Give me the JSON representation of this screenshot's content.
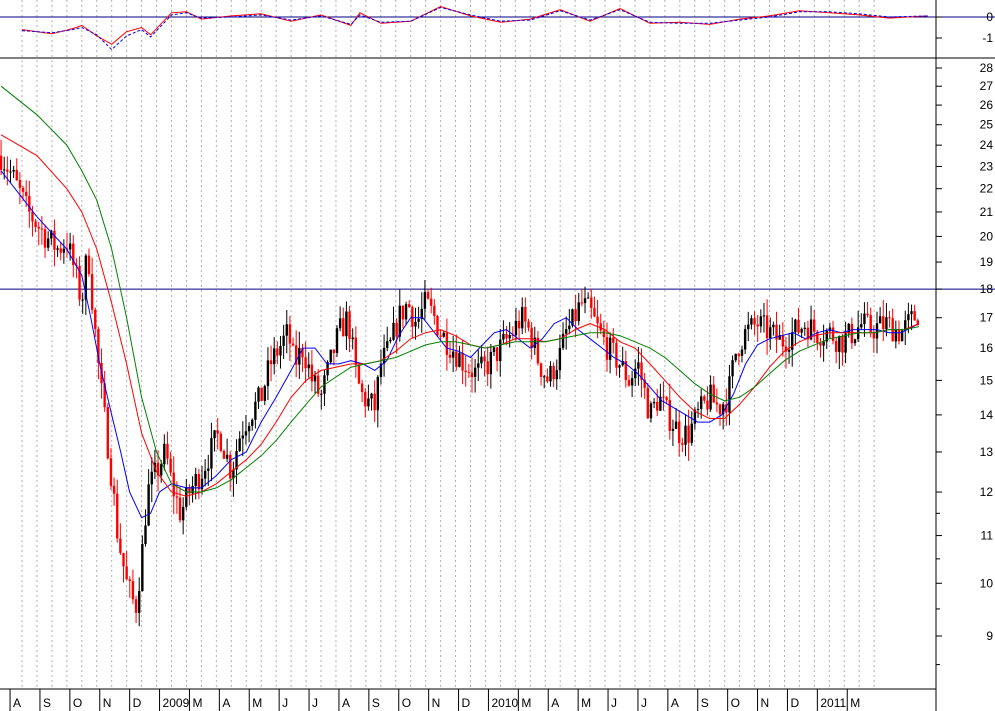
{
  "colors": {
    "background": "#ffffff",
    "grid": "#b0b0b0",
    "frame": "#000000",
    "reference_line": "#000080",
    "candle_down": "#ff0000",
    "candle_up": "#000000",
    "ma_short": "#0000ff",
    "ma_mid": "#ff0000",
    "ma_long": "#008000",
    "osc_solid": "#ff0000",
    "osc_dashed": "#0000ff"
  },
  "chart_data": [
    {
      "type": "line",
      "panel": "oscillator",
      "ylim": [
        -1.8,
        0.4
      ],
      "yticks": [
        0,
        -1
      ],
      "ytick_labels": [
        "0",
        "-1"
      ],
      "reference_y": 0,
      "x_range": [
        0,
        30.5
      ],
      "series": [
        {
          "style": "solid",
          "x": [
            0,
            1,
            1.7,
            2,
            2.5,
            3,
            3.5,
            4,
            4.3,
            5,
            5.5,
            6,
            7,
            8,
            9,
            10,
            11,
            11.3,
            12,
            13,
            14,
            15,
            16,
            17,
            18,
            19,
            20,
            21,
            22,
            23,
            24,
            25,
            26,
            27,
            28,
            29,
            30.3
          ],
          "values": [
            -0.6,
            -0.8,
            -0.55,
            -0.4,
            -0.9,
            -1.3,
            -0.7,
            -0.5,
            -0.85,
            0.2,
            0.25,
            -0.1,
            0.05,
            0.15,
            -0.2,
            0.1,
            -0.4,
            0.2,
            -0.3,
            -0.2,
            0.5,
            0.05,
            -0.25,
            -0.1,
            0.35,
            -0.2,
            0.4,
            -0.3,
            -0.25,
            -0.35,
            -0.1,
            0.05,
            0.3,
            0.2,
            0.1,
            -0.05,
            0.05
          ]
        },
        {
          "style": "dashed",
          "x": [
            0,
            1,
            1.7,
            2,
            2.5,
            3,
            3.5,
            4,
            4.3,
            5,
            5.5,
            6,
            7,
            8,
            9,
            10,
            11,
            11.3,
            12,
            13,
            14,
            15,
            16,
            17,
            18,
            19,
            20,
            21,
            22,
            23,
            24,
            25,
            26,
            27,
            28,
            29,
            30.3
          ],
          "values": [
            -0.65,
            -0.75,
            -0.6,
            -0.5,
            -0.85,
            -1.55,
            -0.9,
            -0.6,
            -0.95,
            0.1,
            0.2,
            -0.05,
            0.0,
            0.1,
            -0.15,
            0.05,
            -0.35,
            0.1,
            -0.25,
            -0.2,
            0.45,
            0.1,
            -0.2,
            -0.15,
            0.3,
            -0.15,
            0.35,
            -0.25,
            -0.3,
            -0.3,
            -0.15,
            0.0,
            0.25,
            0.25,
            0.15,
            0.0,
            0.05
          ]
        }
      ]
    },
    {
      "type": "candlestick",
      "panel": "price",
      "y_scale": "log",
      "ylim": [
        8.3,
        28.6
      ],
      "yticks": [
        9,
        10,
        11,
        12,
        13,
        14,
        15,
        16,
        17,
        18,
        19,
        20,
        21,
        22,
        23,
        24,
        25,
        26,
        27,
        28
      ],
      "ytick_labels": [
        "9",
        "10",
        "11",
        "12",
        "13",
        "14",
        "15",
        "16",
        "17",
        "18",
        "19",
        "20",
        "21",
        "22",
        "23",
        "24",
        "25",
        "26",
        "27",
        "28"
      ],
      "reference_y": 18,
      "x_range": [
        0,
        30.5
      ],
      "xtick_labels": [
        "A",
        "S",
        "O",
        "N",
        "D",
        "2009",
        "M",
        "A",
        "M",
        "J",
        "J",
        "A",
        "S",
        "O",
        "N",
        "D",
        "2010",
        "M",
        "A",
        "M",
        "J",
        "J",
        "A",
        "S",
        "O",
        "N",
        "D",
        "2011",
        "M"
      ],
      "xtick_positions": [
        0,
        1,
        2,
        3,
        4,
        5,
        6,
        7,
        8,
        9,
        10,
        11,
        12,
        13,
        14,
        15,
        16,
        17,
        18,
        19,
        20,
        21,
        22,
        23,
        24,
        25,
        26,
        27,
        28
      ],
      "close_path": {
        "x": [
          -0.7,
          -0.3,
          0.2,
          0.8,
          1.2,
          1.5,
          1.8,
          2.0,
          2.2,
          2.4,
          2.6,
          2.9,
          3.2,
          3.5,
          3.8,
          4.0,
          4.2,
          4.5,
          4.8,
          5.0,
          5.3,
          5.6,
          6.0,
          6.3,
          6.6,
          7.0,
          7.3,
          7.6,
          8.0,
          8.3,
          8.6,
          8.9,
          9.1,
          9.4,
          9.7,
          10.0,
          10.3,
          10.6,
          10.9,
          11.2,
          11.4,
          11.8,
          12.0,
          12.3,
          12.6,
          12.9,
          13.2,
          13.5,
          13.8,
          14.0,
          14.4,
          14.8,
          15.2,
          15.6,
          16.0,
          16.4,
          16.7,
          17.0,
          17.3,
          17.6,
          18.0,
          18.2,
          18.4,
          18.7,
          19.0,
          19.3,
          19.6,
          20.0,
          20.3,
          20.6,
          21.0,
          21.3,
          21.6,
          22.0,
          22.3,
          22.6,
          23.0,
          23.3,
          23.6,
          23.9,
          24.2,
          24.6,
          25.0,
          25.4,
          25.8,
          26.2,
          26.6,
          27.0,
          27.4,
          27.8,
          28.1,
          28.4,
          28.9,
          29.4,
          30.0
        ],
        "values": [
          23.5,
          22.5,
          21.0,
          20.0,
          19.5,
          19.8,
          18.5,
          17.5,
          19.5,
          17.0,
          15.0,
          13.0,
          11.0,
          10.0,
          9.5,
          10.5,
          12.0,
          12.5,
          13.0,
          12.2,
          11.5,
          12.0,
          12.5,
          13.0,
          13.5,
          12.5,
          13.5,
          14.0,
          14.5,
          15.5,
          16.0,
          16.5,
          15.5,
          16.0,
          15.0,
          14.5,
          15.5,
          16.5,
          17.0,
          15.0,
          14.5,
          14.2,
          15.5,
          16.0,
          17.0,
          17.5,
          16.8,
          17.5,
          17.0,
          16.5,
          16.0,
          15.5,
          15.2,
          15.5,
          16.0,
          16.5,
          17.0,
          16.5,
          15.5,
          15.0,
          15.8,
          16.5,
          16.8,
          17.5,
          17.2,
          16.5,
          16.0,
          15.5,
          15.0,
          15.5,
          14.0,
          14.5,
          14.0,
          13.5,
          13.5,
          14.0,
          14.5,
          14.2,
          14.5,
          16.0,
          16.5,
          16.8,
          16.5,
          16.2,
          16.5,
          16.8,
          16.5,
          16.5,
          16.2,
          16.5,
          16.8,
          16.6,
          16.8,
          16.5,
          17.2
        ]
      },
      "series": [
        {
          "style": "ma_short",
          "x": [
            -0.7,
            0.5,
            1.5,
            2.0,
            2.3,
            2.6,
            3.0,
            3.3,
            3.6,
            4.0,
            4.3,
            4.6,
            5.0,
            5.5,
            6.0,
            6.5,
            7.0,
            7.5,
            8.0,
            8.5,
            9.0,
            9.4,
            9.8,
            10.2,
            10.6,
            11.0,
            11.4,
            11.8,
            12.2,
            12.6,
            13.0,
            13.4,
            13.8,
            14.2,
            14.6,
            15.0,
            15.4,
            15.8,
            16.2,
            16.6,
            17.0,
            17.4,
            17.8,
            18.2,
            18.6,
            19.0,
            19.4,
            19.8,
            20.2,
            20.6,
            21.0,
            21.4,
            21.8,
            22.2,
            22.6,
            23.0,
            23.4,
            23.8,
            24.2,
            24.6,
            25.0,
            25.4,
            25.8,
            26.2,
            26.6,
            27.0,
            27.4,
            27.8,
            28.2,
            28.6,
            29.0,
            29.4,
            30.0
          ],
          "values": [
            22.8,
            20.8,
            19.5,
            18.5,
            17.0,
            15.5,
            14.0,
            13.0,
            12.0,
            11.4,
            11.5,
            12.0,
            12.2,
            12.1,
            12.1,
            12.4,
            12.8,
            13.0,
            13.8,
            14.5,
            15.3,
            16.0,
            16.0,
            15.5,
            15.5,
            15.6,
            15.5,
            15.3,
            15.6,
            16.4,
            17.0,
            17.0,
            16.5,
            16.0,
            15.9,
            15.7,
            16.1,
            16.5,
            16.6,
            16.3,
            16.0,
            16.3,
            16.8,
            17.0,
            16.6,
            16.3,
            16.0,
            15.7,
            15.5,
            15.2,
            14.8,
            14.4,
            14.2,
            14.0,
            13.8,
            13.8,
            14.0,
            14.6,
            15.5,
            16.1,
            16.3,
            16.4,
            16.5,
            16.3,
            16.5,
            16.6,
            16.5,
            16.6,
            16.6,
            16.6,
            16.5,
            16.5,
            16.8
          ]
        },
        {
          "style": "ma_mid",
          "x": [
            -0.7,
            0.5,
            1.5,
            2.0,
            2.5,
            3.0,
            3.5,
            4.0,
            4.5,
            5.0,
            5.5,
            6.0,
            6.5,
            7.0,
            7.5,
            8.0,
            8.5,
            9.0,
            9.5,
            10.0,
            10.5,
            11.0,
            11.5,
            12.0,
            12.5,
            13.0,
            13.5,
            14.0,
            14.5,
            15.0,
            15.5,
            16.0,
            16.5,
            17.0,
            17.5,
            18.0,
            18.5,
            19.0,
            19.5,
            20.0,
            20.5,
            21.0,
            21.5,
            22.0,
            22.5,
            23.0,
            23.5,
            24.0,
            24.5,
            25.0,
            25.5,
            26.0,
            26.5,
            27.0,
            27.5,
            28.0,
            28.5,
            29.0,
            29.5,
            30.0
          ],
          "values": [
            24.5,
            23.5,
            22.0,
            21.0,
            19.5,
            17.5,
            15.5,
            13.5,
            12.5,
            12.0,
            11.9,
            12.0,
            12.2,
            12.5,
            12.8,
            13.2,
            13.8,
            14.5,
            15.0,
            15.3,
            15.4,
            15.5,
            15.5,
            15.6,
            15.9,
            16.3,
            16.5,
            16.6,
            16.4,
            16.1,
            16.0,
            16.1,
            16.3,
            16.3,
            16.2,
            16.3,
            16.6,
            16.8,
            16.6,
            16.2,
            16.0,
            15.5,
            15.0,
            14.5,
            14.1,
            13.9,
            13.9,
            14.3,
            14.8,
            15.4,
            15.9,
            16.2,
            16.4,
            16.5,
            16.5,
            16.5,
            16.5,
            16.6,
            16.6,
            16.8
          ]
        },
        {
          "style": "ma_long",
          "x": [
            -0.7,
            0.5,
            1.5,
            2.0,
            2.5,
            3.0,
            3.5,
            4.0,
            4.5,
            5.0,
            5.5,
            6.0,
            6.5,
            7.0,
            7.5,
            8.0,
            8.5,
            9.0,
            9.5,
            10.0,
            10.5,
            11.0,
            11.5,
            12.0,
            12.5,
            13.0,
            13.5,
            14.0,
            14.5,
            15.0,
            15.5,
            16.0,
            16.5,
            17.0,
            17.5,
            18.0,
            18.5,
            19.0,
            19.5,
            20.0,
            20.5,
            21.0,
            21.5,
            22.0,
            22.5,
            23.0,
            23.5,
            24.0,
            24.5,
            25.0,
            25.5,
            26.0,
            26.5,
            27.0,
            27.5,
            28.0,
            28.5,
            29.0,
            29.5,
            30.0
          ],
          "values": [
            27.0,
            25.5,
            24.0,
            22.8,
            21.5,
            19.5,
            17.0,
            14.5,
            13.0,
            12.2,
            12.0,
            12.0,
            12.1,
            12.3,
            12.6,
            12.9,
            13.3,
            13.8,
            14.3,
            14.8,
            15.1,
            15.4,
            15.5,
            15.6,
            15.7,
            15.9,
            16.1,
            16.2,
            16.2,
            16.1,
            16.0,
            16.1,
            16.2,
            16.2,
            16.2,
            16.3,
            16.4,
            16.5,
            16.5,
            16.4,
            16.2,
            16.0,
            15.7,
            15.3,
            14.9,
            14.6,
            14.4,
            14.5,
            14.8,
            15.2,
            15.6,
            15.9,
            16.1,
            16.3,
            16.4,
            16.5,
            16.5,
            16.6,
            16.6,
            16.7
          ]
        }
      ]
    }
  ]
}
